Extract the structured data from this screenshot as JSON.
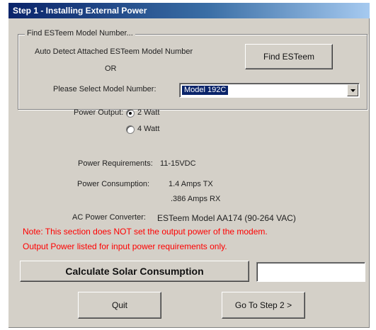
{
  "window": {
    "title": "Step 1 - Installing External Power"
  },
  "model_group": {
    "legend": "Find ESTeem Model Number...",
    "auto_detect_label": "Auto Detect Attached ESTeem Model Number",
    "or_label": "OR",
    "find_button": "Find ESTeem",
    "select_label": "Please Select Model Number:",
    "selected_model": "Model 192C"
  },
  "power_output": {
    "label": "Power Output:",
    "options": [
      {
        "label": "2 Watt",
        "selected": true
      },
      {
        "label": "4 Watt",
        "selected": false
      }
    ]
  },
  "specs": {
    "requirements_label": "Power Requirements:",
    "requirements_value": "11-15VDC",
    "consumption_label": "Power Consumption:",
    "consumption_tx": "1.4 Amps TX",
    "consumption_rx": ".386 Amps RX",
    "converter_label": "AC Power Converter:",
    "converter_value": "ESTeem Model AA174 (90-264 VAC)"
  },
  "note": {
    "line1": "Note: This section does NOT set the output power of the modem.",
    "line2": "Output Power listed for input power requirements only.",
    "color": "#ff0000"
  },
  "solar": {
    "button": "Calculate Solar Consumption",
    "value": ""
  },
  "footer": {
    "quit": "Quit",
    "next": "Go To Step 2 >"
  }
}
